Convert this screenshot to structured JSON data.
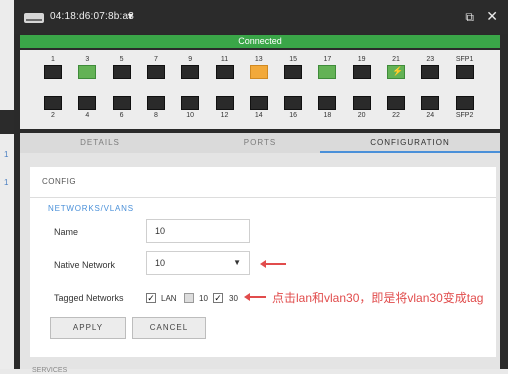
{
  "left_strip": {
    "numbers": [
      "1",
      "1"
    ]
  },
  "window": {
    "mac": "04:18:d6:07:8b:a3",
    "dropdown": "▼",
    "popout_icon": "⧉",
    "close_icon": "✕",
    "status": "Connected"
  },
  "ports": {
    "top": [
      {
        "label": "1",
        "state": "off"
      },
      {
        "label": "3",
        "state": "green"
      },
      {
        "label": "5",
        "state": "off"
      },
      {
        "label": "7",
        "state": "off"
      },
      {
        "label": "9",
        "state": "off"
      },
      {
        "label": "11",
        "state": "off"
      },
      {
        "label": "13",
        "state": "orange"
      },
      {
        "label": "15",
        "state": "off"
      },
      {
        "label": "17",
        "state": "green"
      },
      {
        "label": "19",
        "state": "off"
      },
      {
        "label": "21",
        "state": "green-poe"
      },
      {
        "label": "23",
        "state": "off"
      },
      {
        "label": "SFP1",
        "state": "off"
      }
    ],
    "bottom": [
      {
        "label": "2",
        "state": "off"
      },
      {
        "label": "4",
        "state": "off"
      },
      {
        "label": "6",
        "state": "off"
      },
      {
        "label": "8",
        "state": "off"
      },
      {
        "label": "10",
        "state": "off"
      },
      {
        "label": "12",
        "state": "off"
      },
      {
        "label": "14",
        "state": "off"
      },
      {
        "label": "16",
        "state": "off"
      },
      {
        "label": "18",
        "state": "off"
      },
      {
        "label": "20",
        "state": "off"
      },
      {
        "label": "22",
        "state": "off"
      },
      {
        "label": "24",
        "state": "off"
      },
      {
        "label": "SFP2",
        "state": "off"
      }
    ]
  },
  "tabs": [
    "DETAILS",
    "PORTS",
    "CONFIGURATION"
  ],
  "config": {
    "header": "CONFIG",
    "section": "NETWORKS/VLANS",
    "name_label": "Name",
    "name_value": "10",
    "native_label": "Native Network",
    "native_value": "10",
    "native_caret": "▼",
    "tagged_label": "Tagged Networks",
    "tagged": [
      {
        "label": "LAN",
        "checked": true
      },
      {
        "label": "10",
        "checked": false
      },
      {
        "label": "30",
        "checked": true
      }
    ],
    "apply": "APPLY",
    "cancel": "CANCEL",
    "bottom_partial": "SERVICES"
  },
  "annotation": "点击lan和vlan30，即是将vlan30变成tag",
  "colors": {
    "accent": "#4a90d9",
    "connected": "#3aa648",
    "port_green": "#63b255",
    "port_orange": "#f2a93a",
    "annotation": "#e14c4c"
  }
}
